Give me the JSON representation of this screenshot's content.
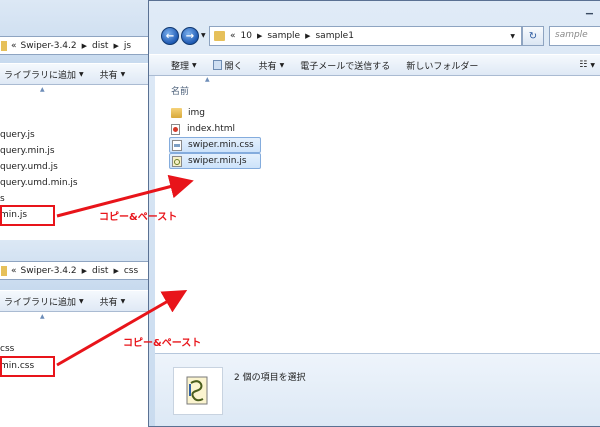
{
  "left_top": {
    "breadcrumb": [
      "Swiper-3.4.2",
      "dist",
      "js"
    ],
    "toolbar": {
      "include_library": "ライブラリに追加",
      "share": "共有"
    },
    "files": [
      "query.js",
      "query.min.js",
      "query.umd.js",
      "query.umd.min.js",
      "s",
      "min.js"
    ]
  },
  "left_bottom": {
    "breadcrumb": [
      "Swiper-3.4.2",
      "dist",
      "css"
    ],
    "toolbar": {
      "include_library": "ライブラリに追加",
      "share": "共有"
    },
    "files": [
      "css",
      "min.css"
    ]
  },
  "right": {
    "breadcrumb": [
      "10",
      "sample",
      "sample1"
    ],
    "search_placeholder": "sample",
    "toolbar": {
      "organize": "整理",
      "open": "開く",
      "share": "共有",
      "email": "電子メールで送信する",
      "new_folder": "新しいフォルダー"
    },
    "column_header": "名前",
    "files": [
      {
        "name": "img",
        "icon": "folder-icon"
      },
      {
        "name": "index.html",
        "icon": "html-file-icon"
      },
      {
        "name": "swiper.min.css",
        "icon": "css-file-icon",
        "selected": true
      },
      {
        "name": "swiper.min.js",
        "icon": "js-file-icon",
        "selected": true
      }
    ],
    "status": "2 個の項目を選択"
  },
  "annotations": {
    "copy_paste_1": "コピー&ペースト",
    "copy_paste_2": "コピー&ペースト"
  },
  "colors": {
    "annotation_red": "#e8141a",
    "selection_blue": "#cde3fa",
    "glass": "#c6d9ee"
  }
}
